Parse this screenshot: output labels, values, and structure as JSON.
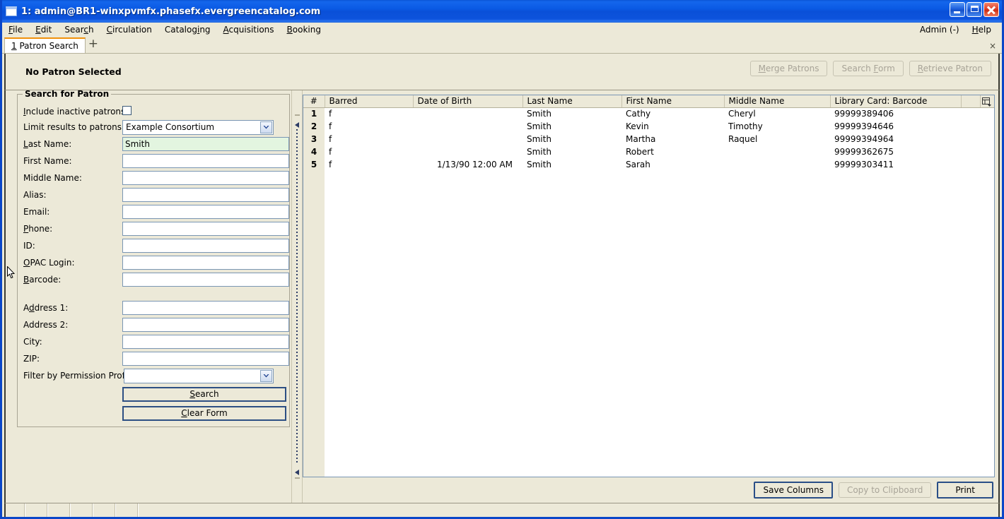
{
  "window": {
    "title": "1: admin@BR1-winxpvmfx.phasefx.evergreencatalog.com",
    "icon": "window-icon",
    "minimize_label": "Minimize",
    "maximize_label": "Maximize",
    "close_label": "Close"
  },
  "menubar": {
    "items": [
      {
        "label": "File",
        "accel": "F"
      },
      {
        "label": "Edit",
        "accel": "E"
      },
      {
        "label": "Search",
        "accel": "c"
      },
      {
        "label": "Circulation",
        "accel": "C"
      },
      {
        "label": "Cataloging",
        "accel": "g"
      },
      {
        "label": "Acquisitions",
        "accel": "A"
      },
      {
        "label": "Booking",
        "accel": "B"
      }
    ],
    "admin_label": "Admin (-)",
    "help_label": "Help"
  },
  "tabs": {
    "items": [
      {
        "number": "1",
        "label": "Patron Search",
        "active": true
      }
    ],
    "new_tab_label": "+",
    "close_tab_label": "×"
  },
  "patron_header": {
    "status": "No Patron Selected",
    "buttons": [
      {
        "label": "Merge Patrons",
        "accel": "M",
        "rest": "erge Patrons",
        "disabled": true
      },
      {
        "label": "Search Form",
        "accel": "F",
        "pre": "Search ",
        "rest": "orm",
        "disabled": true
      },
      {
        "label": "Retrieve Patron",
        "accel": "R",
        "rest": "etrieve Patron",
        "disabled": true
      }
    ]
  },
  "search_form": {
    "legend": "Search for Patron",
    "fields": [
      {
        "label": "Include inactive patrons?",
        "accel": "I",
        "rest": "nclude inactive patrons?",
        "type": "checkbox",
        "checked": false,
        "value": ""
      },
      {
        "label": "Limit results to patrons in",
        "type": "select",
        "value": "Example Consortium"
      },
      {
        "label": "Last Name:",
        "accel": "L",
        "rest": "ast Name:",
        "type": "text",
        "value": "Smith",
        "focused": true
      },
      {
        "label": "First Name:",
        "type": "text",
        "value": ""
      },
      {
        "label": "Middle Name:",
        "type": "text",
        "value": ""
      },
      {
        "label": "Alias:",
        "type": "text",
        "value": ""
      },
      {
        "label": "Email:",
        "type": "text",
        "value": ""
      },
      {
        "label": "Phone:",
        "accel": "P",
        "rest": "hone:",
        "type": "text",
        "value": ""
      },
      {
        "label": "ID:",
        "type": "text",
        "value": ""
      },
      {
        "label": "OPAC Login:",
        "accel": "O",
        "rest": "PAC Login:",
        "type": "text",
        "value": ""
      },
      {
        "label": "Barcode:",
        "accel": "B",
        "rest": "arcode:",
        "type": "text",
        "value": ""
      },
      {
        "label": "Address 1:",
        "accel": "d",
        "pre": "A",
        "rest": "dress 1:",
        "type": "text",
        "value": ""
      },
      {
        "label": "Address 2:",
        "type": "text",
        "value": ""
      },
      {
        "label": "City:",
        "type": "text",
        "value": ""
      },
      {
        "label": "ZIP:",
        "type": "text",
        "value": ""
      },
      {
        "label": "Filter by Permission Profile:",
        "type": "select",
        "value": ""
      }
    ],
    "search_button": {
      "label": "Search",
      "accel": "S",
      "rest": "earch"
    },
    "clear_button": {
      "label": "Clear Form",
      "accel": "C",
      "rest": "lear Form"
    }
  },
  "results": {
    "columns": [
      "#",
      "Barred",
      "Date of Birth",
      "Last Name",
      "First Name",
      "Middle Name",
      "Library Card: Barcode"
    ],
    "column_picker_icon": "column-picker-icon",
    "rows": [
      {
        "num": "1",
        "barred": "f",
        "dob": "",
        "last": "Smith",
        "first": "Cathy",
        "middle": "Cheryl",
        "barcode": "99999389406"
      },
      {
        "num": "2",
        "barred": "f",
        "dob": "",
        "last": "Smith",
        "first": "Kevin",
        "middle": "Timothy",
        "barcode": "99999394646"
      },
      {
        "num": "3",
        "barred": "f",
        "dob": "",
        "last": "Smith",
        "first": "Martha",
        "middle": "Raquel",
        "barcode": "99999394964"
      },
      {
        "num": "4",
        "barred": "f",
        "dob": "",
        "last": "Smith",
        "first": "Robert",
        "middle": "",
        "barcode": "99999362675"
      },
      {
        "num": "5",
        "barred": "f",
        "dob": "1/13/90 12:00 AM",
        "last": "Smith",
        "first": "Sarah",
        "middle": "",
        "barcode": "99999303411"
      }
    ],
    "footer_buttons": [
      {
        "label": "Save Columns",
        "disabled": false,
        "strong": true
      },
      {
        "label": "Copy to Clipboard",
        "disabled": true,
        "strong": false
      },
      {
        "label": "Print",
        "disabled": false,
        "strong": true
      }
    ]
  },
  "colors": {
    "titlebar_blue": "#0a50d8",
    "window_chrome": "#ece9d8",
    "tab_accent": "#f0920b",
    "field_focus_green": "#e3f5e0",
    "field_border": "#7a96b4",
    "button_strong_border": "#294e87"
  }
}
